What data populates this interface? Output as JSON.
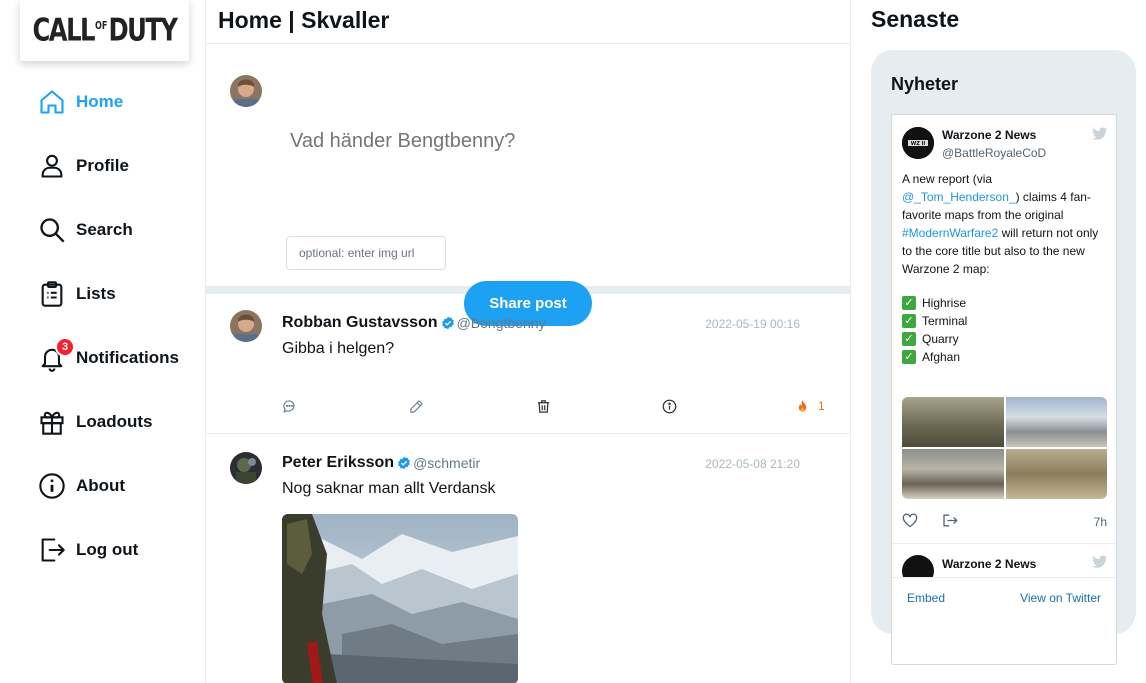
{
  "sidebar": {
    "logo": "CALL OF DUTY",
    "items": [
      {
        "label": "Home",
        "icon": "home-icon",
        "active": true
      },
      {
        "label": "Profile",
        "icon": "user-icon"
      },
      {
        "label": "Search",
        "icon": "search-icon"
      },
      {
        "label": "Lists",
        "icon": "clipboard-icon"
      },
      {
        "label": "Notifications",
        "icon": "bell-icon",
        "badge": "3"
      },
      {
        "label": "Loadouts",
        "icon": "gift-icon"
      },
      {
        "label": "About",
        "icon": "info-icon"
      },
      {
        "label": "Log out",
        "icon": "logout-icon"
      }
    ]
  },
  "main": {
    "title": "Home | Skvaller",
    "composer": {
      "placeholder": "Vad händer Bengtbenny?",
      "img_placeholder": "optional: enter img url",
      "share_label": "Share post"
    },
    "posts": [
      {
        "name": "Robban Gustavsson",
        "handle": "@Bengtbenny",
        "date": "2022-05-19 00:16",
        "text": "Gibba i helgen?",
        "fire_count": "1"
      },
      {
        "name": "Peter Eriksson",
        "handle": "@schmetir",
        "date": "2022-05-08 21:20",
        "text": "Nog saknar man allt Verdansk"
      }
    ]
  },
  "right": {
    "title": "Senaste",
    "news": {
      "title": "Nyheter",
      "tweet": {
        "name": "Warzone 2 News",
        "handle": "@BattleRoyaleCoD",
        "text_1": "A new report (via ",
        "link_1": "@_Tom_Henderson_",
        "text_2": ") claims 4 fan-favorite maps from the original ",
        "link_2": "#ModernWarfare2",
        "text_3": " will return not only to the core title but also to the new Warzone 2 map:",
        "maps": [
          "Highrise",
          "Terminal",
          "Quarry",
          "Afghan"
        ],
        "time": "7h"
      },
      "tweet2_name": "Warzone 2 News",
      "embed_label": "Embed",
      "view_label": "View on Twitter"
    }
  },
  "colors": {
    "accent": "#1da1f2",
    "badge": "#f4212e",
    "fire": "#e8740b",
    "verified": "#1d9bf0"
  }
}
